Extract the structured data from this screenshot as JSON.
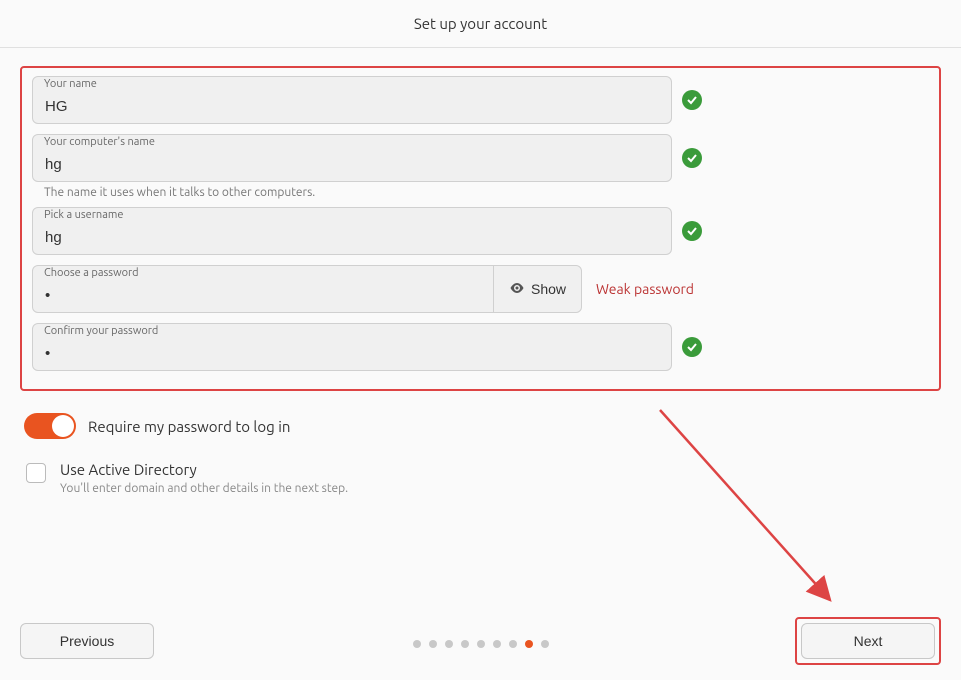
{
  "header": {
    "title": "Set up your account"
  },
  "form": {
    "name": {
      "label": "Your name",
      "value": "HG"
    },
    "computer": {
      "label": "Your computer's name",
      "value": "hg",
      "helper": "The name it uses when it talks to other computers."
    },
    "username": {
      "label": "Pick a username",
      "value": "hg"
    },
    "password": {
      "label": "Choose a password",
      "value": "•",
      "show_label": "Show",
      "strength": "Weak password"
    },
    "confirm": {
      "label": "Confirm your password",
      "value": "•"
    }
  },
  "options": {
    "require_password": {
      "label": "Require my password to log in",
      "checked": true
    },
    "active_directory": {
      "label": "Use Active Directory",
      "sub": "You'll enter domain and other details in the next step.",
      "checked": false
    }
  },
  "footer": {
    "previous": "Previous",
    "next": "Next",
    "step_count": 9,
    "active_step": 8
  },
  "colors": {
    "accent": "#e95420",
    "valid": "#3a9b3a",
    "highlight": "#d44"
  }
}
